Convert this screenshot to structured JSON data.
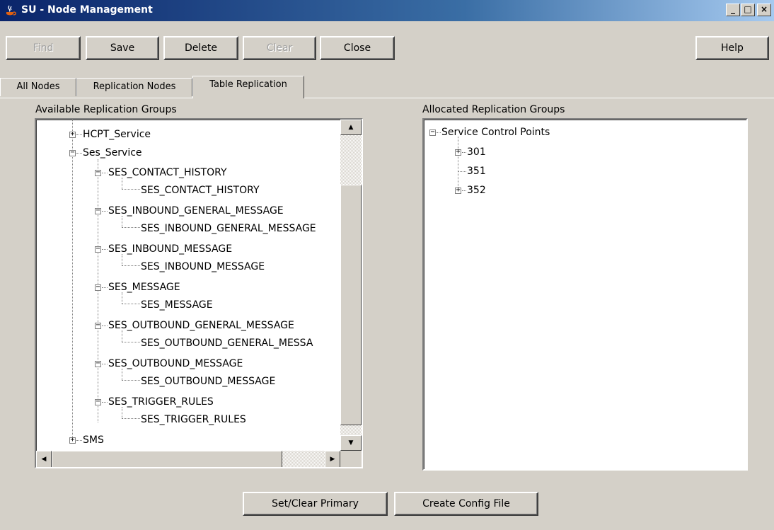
{
  "window": {
    "title": "SU - Node Management",
    "minimize": "_",
    "maximize": "□",
    "close": "×"
  },
  "toolbar": {
    "find": "Find",
    "save": "Save",
    "delete": "Delete",
    "clear": "Clear",
    "close": "Close",
    "help": "Help"
  },
  "tabs": [
    "All Nodes",
    "Replication Nodes",
    "Table Replication"
  ],
  "active_tab": "Table Replication",
  "available": {
    "label": "Available Replication Groups",
    "items": [
      "HCPT_Service",
      "Ses_Service",
      "SES_CONTACT_HISTORY",
      "SES_CONTACT_HISTORY",
      "SES_INBOUND_GENERAL_MESSAGE",
      "SES_INBOUND_GENERAL_MESSAGE",
      "SES_INBOUND_MESSAGE",
      "SES_INBOUND_MESSAGE",
      "SES_MESSAGE",
      "SES_MESSAGE",
      "SES_OUTBOUND_GENERAL_MESSAGE",
      "SES_OUTBOUND_GENERAL_MESSA",
      "SES_OUTBOUND_MESSAGE",
      "SES_OUTBOUND_MESSAGE",
      "SES_TRIGGER_RULES",
      "SES_TRIGGER_RULES",
      "SMS"
    ]
  },
  "allocated": {
    "label": "Allocated Replication Groups",
    "items": [
      "Service Control Points",
      "301",
      "351",
      "352"
    ]
  },
  "bottom": {
    "set_clear_primary": "Set/Clear Primary",
    "create_config": "Create Config File"
  }
}
